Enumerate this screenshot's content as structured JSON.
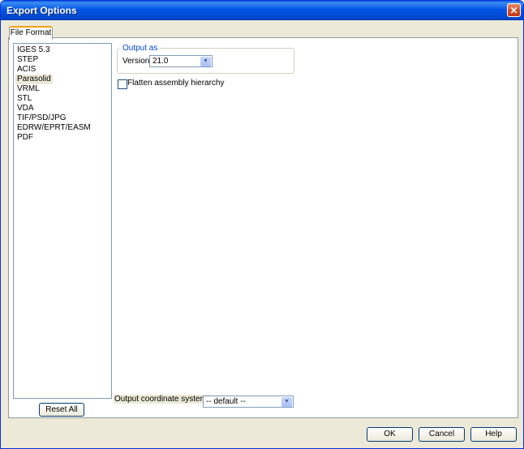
{
  "window": {
    "title": "Export Options",
    "close_label": "✕"
  },
  "tabs": [
    {
      "label": "File Format"
    }
  ],
  "formats": {
    "items": [
      "IGES 5.3",
      "STEP",
      "ACIS",
      "Parasolid",
      "VRML",
      "STL",
      "VDA",
      "TIF/PSD/JPG",
      "EDRW/EPRT/EASM",
      "PDF"
    ],
    "selected": "Parasolid"
  },
  "output": {
    "group_label": "Output as",
    "version_label": "Version:",
    "version_value": "21.0",
    "flatten_label": "Flatten assembly hierarchy",
    "flatten_checked": false
  },
  "coordinate": {
    "label": "Output coordinate system:",
    "value": "-- default --"
  },
  "buttons": {
    "reset_all": "Reset All",
    "ok": "OK",
    "cancel": "Cancel",
    "help": "Help"
  }
}
